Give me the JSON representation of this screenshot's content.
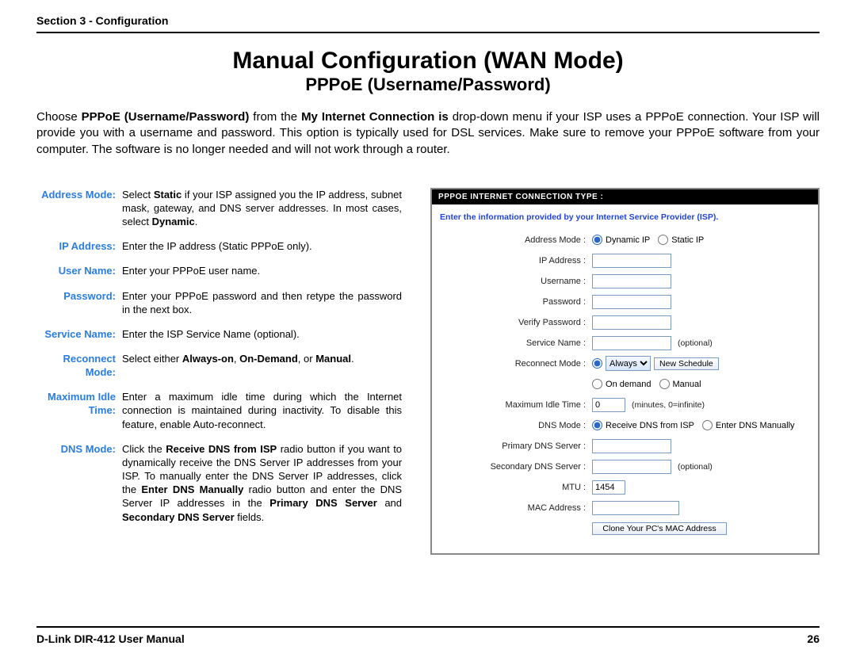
{
  "header": {
    "section": "Section 3 - Configuration"
  },
  "title": "Manual Configuration (WAN Mode)",
  "subtitle": "PPPoE (Username/Password)",
  "intro_pre": "Choose ",
  "intro_b1": "PPPoE (Username/Password)",
  "intro_mid1": " from the ",
  "intro_b2": "My Internet Connection is",
  "intro_post": " drop-down menu if your ISP uses a PPPoE connection. Your ISP will provide you with a username and password. This option is typically used for DSL services. Make sure to remove your PPPoE software from your computer. The software is no longer needed and will not work through a router.",
  "defs": {
    "address_mode": {
      "term": "Address Mode:",
      "p1": "Select ",
      "b1": "Static",
      "p2": " if your ISP assigned you the IP address, subnet mask, gateway, and DNS server addresses. In most cases, select ",
      "b2": "Dynamic",
      "p3": "."
    },
    "ip_address": {
      "term": "IP Address:",
      "body": "Enter the IP address (Static PPPoE only)."
    },
    "user_name": {
      "term": "User Name:",
      "body": "Enter your PPPoE user name."
    },
    "password": {
      "term": "Password:",
      "body": "Enter your PPPoE password and then retype the password in the next box."
    },
    "service_name": {
      "term": "Service Name:",
      "body": "Enter the ISP Service Name (optional)."
    },
    "reconnect": {
      "term": "Reconnect Mode:",
      "p1": "Select either ",
      "b1": "Always-on",
      "p2": ", ",
      "b2": "On-Demand",
      "p3": ", or ",
      "b3": "Manual",
      "p4": "."
    },
    "max_idle": {
      "term": "Maximum Idle Time:",
      "body": "Enter a maximum idle time during which the Internet connection is maintained during inactivity. To disable this feature, enable Auto-reconnect."
    },
    "dns_mode": {
      "term": "DNS Mode:",
      "p1": "Click the ",
      "b1": "Receive DNS from ISP",
      "p2": " radio button if you want to dynamically receive the DNS Server IP addresses from your ISP. To manually enter the DNS Server IP addresses, click the ",
      "b2": "Enter DNS Manually",
      "p3": " radio button and enter the DNS Server IP addresses in the ",
      "b3": "Primary DNS Server",
      "p4": " and ",
      "b4": "Secondary DNS Server",
      "p5": " fields."
    }
  },
  "panel": {
    "header": "PPPOE INTERNET CONNECTION TYPE :",
    "instruction": "Enter the information provided by your Internet Service Provider (ISP).",
    "labels": {
      "address_mode": "Address Mode",
      "ip_address": "IP Address",
      "username": "Username",
      "password": "Password",
      "verify_password": "Verify Password",
      "service_name": "Service Name",
      "reconnect_mode": "Reconnect Mode",
      "max_idle": "Maximum Idle Time",
      "dns_mode": "DNS Mode",
      "primary_dns": "Primary DNS Server",
      "secondary_dns": "Secondary DNS Server",
      "mtu": "MTU",
      "mac": "MAC Address"
    },
    "radios": {
      "dynamic_ip": "Dynamic IP",
      "static_ip": "Static IP",
      "on_demand": "On demand",
      "manual": "Manual",
      "dns_isp": "Receive DNS from ISP",
      "dns_manual": "Enter DNS Manually"
    },
    "values": {
      "reconnect_select": "Always",
      "max_idle": "0",
      "mtu": "1454"
    },
    "hints": {
      "optional": "(optional)",
      "minutes": "(minutes, 0=infinite)"
    },
    "buttons": {
      "new_schedule": "New Schedule",
      "clone_mac": "Clone Your PC's MAC Address"
    }
  },
  "footer": {
    "left": "D-Link DIR-412 User Manual",
    "right": "26"
  }
}
